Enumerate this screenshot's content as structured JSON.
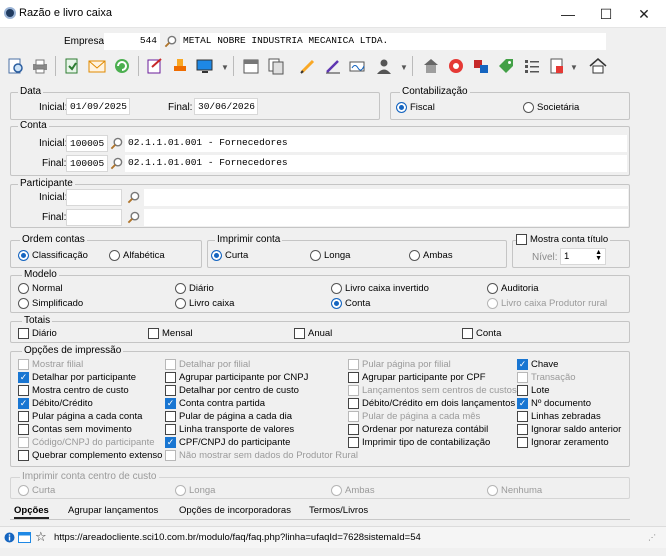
{
  "window": {
    "title": "Razão e livro caixa",
    "minimize": "—",
    "maximize": "☐",
    "close": "✕"
  },
  "empresa": {
    "label": "Empresa:",
    "code": "544",
    "name": "METAL NOBRE INDUSTRIA MECANICA LTDA."
  },
  "toolbar": {
    "icons": [
      "preview-icon",
      "print-icon",
      "export-icon",
      "email-icon",
      "refresh-icon",
      "edit-icon",
      "stamp-icon",
      "monitor-icon",
      "calendar-icon",
      "copy-icon",
      "pencil-icon",
      "edit-note-icon",
      "signature-icon",
      "user-icon",
      "building-icon",
      "lifebuoy-icon",
      "config-icon",
      "tag-icon",
      "list-icon",
      "document-icon",
      "home-icon"
    ]
  },
  "data": {
    "group_title": "Data",
    "inicial_label": "Inicial:",
    "inicial_value": "01/09/2025",
    "final_label": "Final:",
    "final_value": "30/06/2026"
  },
  "contabilizacao": {
    "group_title": "Contabilização",
    "options": [
      "Fiscal",
      "Societária"
    ],
    "selected": "Fiscal"
  },
  "conta": {
    "group_title": "Conta",
    "inicial_label": "Inicial:",
    "inicial_code": "100005",
    "inicial_desc": "02.1.1.01.001 - Fornecedores",
    "final_label": "Final:",
    "final_code": "100005",
    "final_desc": "02.1.1.01.001 - Fornecedores"
  },
  "participante": {
    "group_title": "Participante",
    "inicial_label": "Inicial:",
    "final_label": "Final:"
  },
  "ordem_contas": {
    "group_title": "Ordem contas",
    "options": [
      "Classificação",
      "Alfabética"
    ],
    "selected": "Classificação"
  },
  "imprimir_conta": {
    "group_title": "Imprimir conta",
    "options": [
      "Curta",
      "Longa",
      "Ambas"
    ],
    "selected": "Curta"
  },
  "mostra_conta_titulo": {
    "label": "Mostra conta título",
    "nivel_label": "Nível:",
    "nivel_value": "1"
  },
  "modelo": {
    "group_title": "Modelo",
    "options": [
      "Normal",
      "Diário",
      "Livro caixa invertido",
      "Auditoria",
      "Simplificado",
      "Livro caixa",
      "Conta",
      "Livro caixa Produtor rural"
    ],
    "selected": "Conta"
  },
  "totais": {
    "group_title": "Totais",
    "options": [
      "Diário",
      "Mensal",
      "Anual",
      "Conta"
    ]
  },
  "opcoes_impressao": {
    "group_title": "Opções de impressão",
    "items": [
      {
        "label": "Mostrar filial",
        "checked": false,
        "disabled": true
      },
      {
        "label": "Detalhar por participante",
        "checked": true,
        "disabled": false
      },
      {
        "label": "Mostra centro de custo",
        "checked": false,
        "disabled": false
      },
      {
        "label": "Débito/Crédito",
        "checked": true,
        "disabled": false
      },
      {
        "label": "Pular página a cada conta",
        "checked": false,
        "disabled": false
      },
      {
        "label": "Contas sem movimento",
        "checked": false,
        "disabled": false
      },
      {
        "label": "Código/CNPJ do participante",
        "checked": false,
        "disabled": true
      },
      {
        "label": "Quebrar complemento extenso",
        "checked": false,
        "disabled": false
      },
      {
        "label": "Detalhar por filial",
        "checked": false,
        "disabled": true
      },
      {
        "label": "Agrupar participante por CNPJ",
        "checked": false,
        "disabled": false
      },
      {
        "label": "Detalhar por centro de custo",
        "checked": false,
        "disabled": false
      },
      {
        "label": "Conta contra partida",
        "checked": true,
        "disabled": false
      },
      {
        "label": "Pular de página a cada dia",
        "checked": false,
        "disabled": false
      },
      {
        "label": "Linha transporte de valores",
        "checked": false,
        "disabled": false
      },
      {
        "label": "CPF/CNPJ do participante",
        "checked": true,
        "disabled": false
      },
      {
        "label": "Não mostrar sem dados do Produtor Rural",
        "checked": false,
        "disabled": true
      },
      {
        "label": "Pular página por filial",
        "checked": false,
        "disabled": true
      },
      {
        "label": "Agrupar participante por CPF",
        "checked": false,
        "disabled": false
      },
      {
        "label": "Lançamentos sem centros de custos",
        "checked": false,
        "disabled": true
      },
      {
        "label": "Débito/Crédito em dois lançamentos",
        "checked": false,
        "disabled": false
      },
      {
        "label": "Pular de página a cada mês",
        "checked": false,
        "disabled": true
      },
      {
        "label": "Ordenar por natureza contábil",
        "checked": false,
        "disabled": false
      },
      {
        "label": "Imprimir tipo de contabilização",
        "checked": false,
        "disabled": false
      },
      {
        "label": "Chave",
        "checked": true,
        "disabled": false
      },
      {
        "label": "Transação",
        "checked": false,
        "disabled": true
      },
      {
        "label": "Lote",
        "checked": false,
        "disabled": false
      },
      {
        "label": "Nº documento",
        "checked": true,
        "disabled": false
      },
      {
        "label": "Linhas zebradas",
        "checked": false,
        "disabled": false
      },
      {
        "label": "Ignorar saldo anterior",
        "checked": false,
        "disabled": false
      },
      {
        "label": "Ignorar zeramento",
        "checked": false,
        "disabled": false
      }
    ]
  },
  "imprimir_centro_custo": {
    "group_title": "Imprimir conta centro de custo",
    "options": [
      "Curta",
      "Longa",
      "Ambas",
      "Nenhuma"
    ]
  },
  "tabs": [
    "Opções",
    "Agrupar lançamentos",
    "Opções de incorporadoras",
    "Termos/Livros"
  ],
  "statusbar": {
    "url": "https://areadocliente.sci10.com.br/modulo/faq/faq.php?linha=ufaqId=7628sistemaId=54"
  }
}
